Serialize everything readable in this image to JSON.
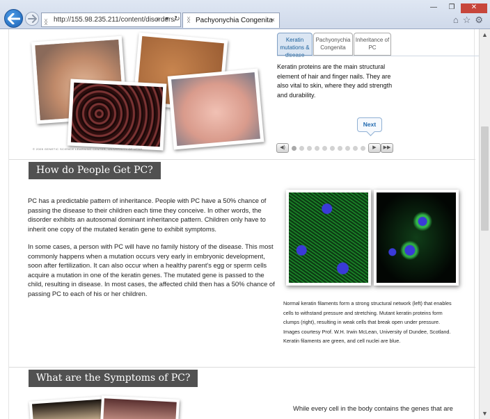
{
  "browser": {
    "url": "http://155.98.235.211/content/disorders/",
    "tab_title": "Pachyonychia Congenita",
    "tab_close": "×",
    "address_tools": [
      "⌕",
      "▾",
      "↻"
    ],
    "window_controls": [
      "—",
      "❐",
      "✕"
    ],
    "toolbar_icons": [
      "home-icon",
      "favorites-star-icon",
      "settings-gear-icon"
    ]
  },
  "interactive": {
    "tabs": [
      {
        "label": "Keratin mutations & disease",
        "active": true
      },
      {
        "label": "Pachyonychia Congenita",
        "active": false
      },
      {
        "label": "Inheritance of PC",
        "active": false
      }
    ],
    "text": "Keratin proteins are the main structural element of hair and finger nails. They are also vital to skin, where they add strength and durability.",
    "next_label": "Next",
    "copyright": "© 2005 GENETIC SCIENCE LEARNING CENTER, UNIVERSITY OF UTAH",
    "slide_count": 10,
    "current_slide": 1
  },
  "section_inheritance": {
    "heading": "How do People Get PC?",
    "paragraph_1": "PC has a predictable pattern of inheritance. People with PC have a 50% chance of passing the disease to their children each time they conceive. In other words, the disorder exhibits an autosomal dominant inheritance pattern. Children only have to inherit one copy of the mutated keratin gene to exhibit symptoms.",
    "paragraph_2": "In some cases, a person with PC will have no family history of the disease. This most commonly happens when a mutation occurs very early in embryonic development, soon after fertilization. It can also occur when a healthy parent's egg or sperm cells acquire a mutation in one of the keratin genes. The mutated gene is passed to the child, resulting in disease. In most cases, the affected child then has a 50% chance of passing PC to each of his or her children.",
    "caption": "Normal keratin filaments form a strong structural network (left) that enables cells to withstand pressure and stretching. Mutant keratin proteins form clumps (right), resulting in weak cells that break open under pressure. Images courtesy Prof. W.H. Irwin McLean, University of Dundee, Scotland. Keratin filaments are green, and cell nuclei are blue."
  },
  "section_symptoms": {
    "heading": "What are the Symptoms of PC?",
    "text_start": "While every cell in the body contains the genes that are"
  }
}
